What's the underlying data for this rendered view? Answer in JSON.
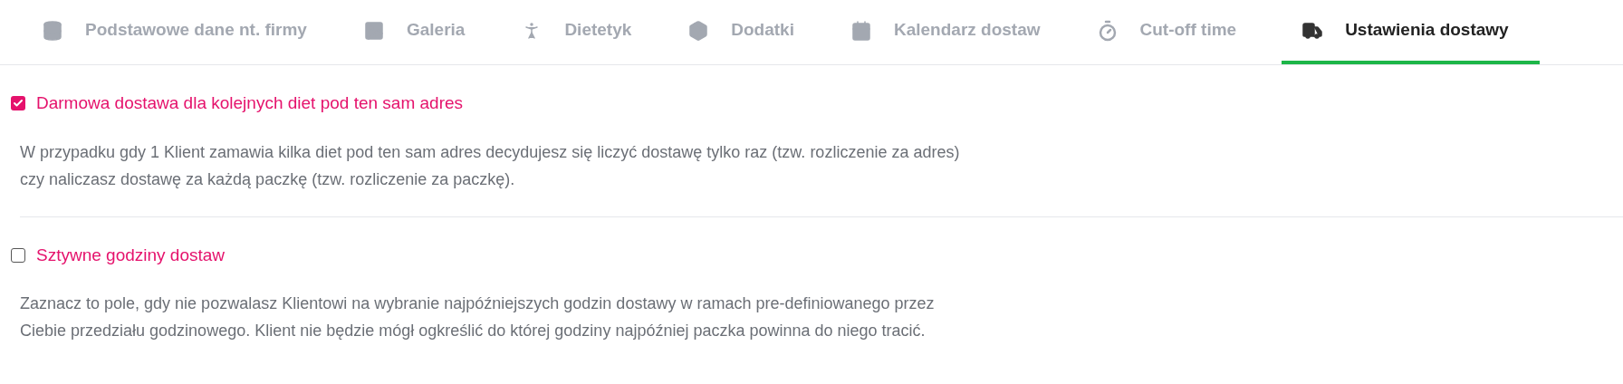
{
  "tabs": [
    {
      "label": "Podstawowe dane nt. firmy",
      "selected": false
    },
    {
      "label": "Galeria",
      "selected": false
    },
    {
      "label": "Dietetyk",
      "selected": false
    },
    {
      "label": "Dodatki",
      "selected": false
    },
    {
      "label": "Kalendarz dostaw",
      "selected": false
    },
    {
      "label": "Cut-off time",
      "selected": false
    },
    {
      "label": "Ustawienia dostawy",
      "selected": true
    }
  ],
  "settings": [
    {
      "label": "Darmowa dostawa dla kolejnych diet pod ten sam adres",
      "checked": true,
      "description": "W przypadku gdy 1 Klient zamawia kilka diet pod ten sam adres decydujesz się liczyć dostawę tylko raz (tzw. rozliczenie za adres) czy naliczasz dostawę za każdą paczkę (tzw. rozliczenie za paczkę)."
    },
    {
      "label": "Sztywne godziny dostaw",
      "checked": false,
      "description": "Zaznacz to pole, gdy nie pozwalasz Klientowi na wybranie najpóźniejszych godzin dostawy w ramach pre-definiowanego przez Ciebie przedziału godzinowego. Klient nie będzie mógł ogkreślić do której godziny najpóźniej paczka powinna do niego tracić."
    }
  ]
}
